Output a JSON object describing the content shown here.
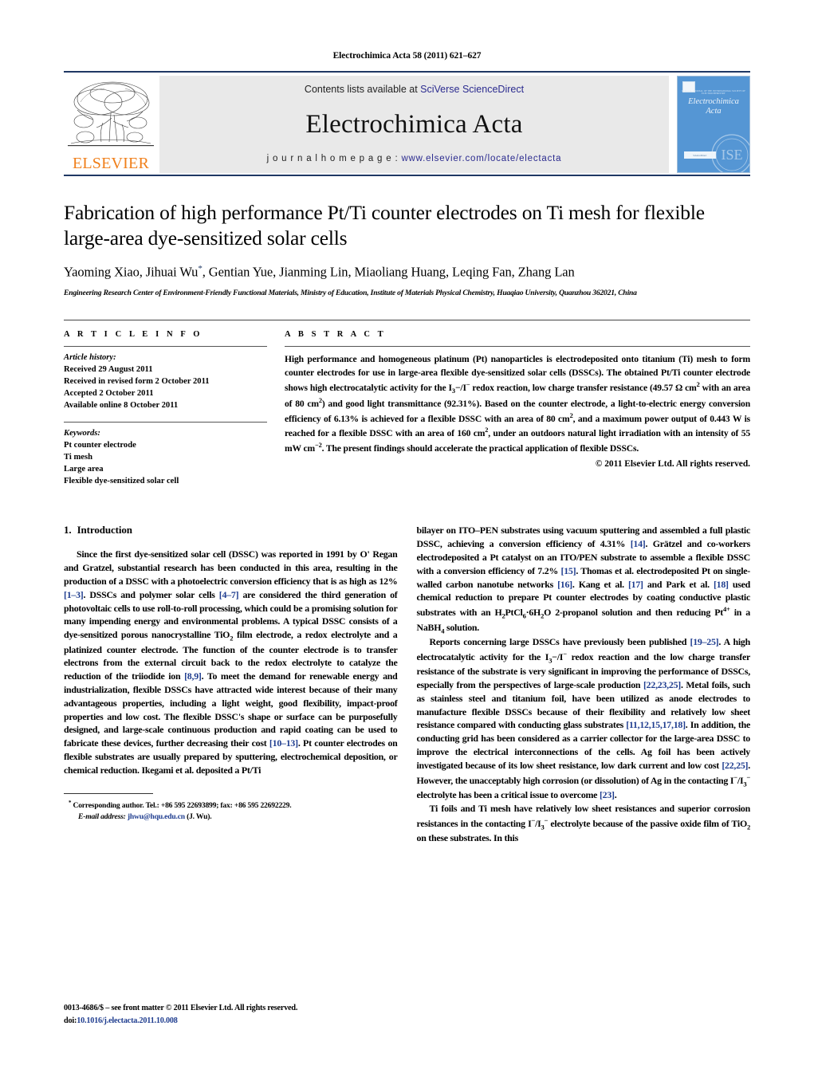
{
  "running_head": "Electrochimica Acta 58 (2011) 621–627",
  "masthead": {
    "publisher_logo_text": "ELSEVIER",
    "contents_prefix": "Contents lists available at ",
    "contents_link": "SciVerse ScienceDirect",
    "journal_name": "Electrochimica Acta",
    "homepage_prefix": "j o u r n a l   h o m e p a g e :  ",
    "homepage_url": "www.elsevier.com/locate/electacta",
    "cover_title_line1": "Electrochimica",
    "cover_title_line2": "Acta",
    "cover_society_line": "OFFICIAL JOURNAL OF THE INTERNATIONAL SOCIETY OF ELECTROCHEMISTRY",
    "cover_sciencedirect": "ScienceDirect",
    "cover_ise_mark": "ISE",
    "accent_rule_color": "#1f3864",
    "link_color": "#2b2b8f",
    "elsevier_orange": "#F07F1A",
    "cover_blue": "#5596d4"
  },
  "article": {
    "title": "Fabrication of high performance Pt/Ti counter electrodes on Ti mesh for flexible large-area dye-sensitized solar cells",
    "authors": "Yaoming Xiao, Jihuai Wu",
    "authors_rest": ", Gentian Yue, Jianming Lin, Miaoliang Huang, Leqing Fan, Zhang Lan",
    "corresponding_marker": "*",
    "affiliation": "Engineering Research Center of Environment-Friendly Functional Materials, Ministry of Education, Institute of Materials Physical Chemistry, Huaqiao University, Quanzhou 362021, China"
  },
  "article_info": {
    "heading": "A R T I C L E   I N F O",
    "history_label": "Article history:",
    "history": [
      "Received 29 August 2011",
      "Received in revised form 2 October 2011",
      "Accepted 2 October 2011",
      "Available online 8 October 2011"
    ],
    "keywords_label": "Keywords:",
    "keywords": [
      "Pt counter electrode",
      "Ti mesh",
      "Large area",
      "Flexible dye-sensitized solar cell"
    ]
  },
  "abstract": {
    "heading": "A B S T R A C T",
    "para_1": "High performance and homogeneous platinum (Pt) nanoparticles is electrodeposited onto titanium (Ti) mesh to form counter electrodes for use in large-area flexible dye-sensitized solar cells (DSSCs). The obtained Pt/Ti counter electrode shows high electrocatalytic activity for the I",
    "redox_sub": "3",
    "redox_mid": "−/I",
    "redox_sup": "−",
    "para_2": " redox reaction, low charge transfer resistance (49.57 Ω cm",
    "sup_2a": "2",
    "para_3": " with an area of 80 cm",
    "sup_2b": "2",
    "para_4": ") and good light transmittance (92.31%). Based on the counter electrode, a light-to-electric energy conversion efficiency of 6.13% is achieved for a flexible DSSC with an area of 80 cm",
    "sup_2c": "2",
    "para_5": ", and a maximum power output of 0.443 W is reached for a flexible DSSC with an area of 160 cm",
    "sup_2d": "2",
    "para_6": ", under an outdoors natural light irradiation with an intensity of 55 mW cm",
    "sup_2e": "−2",
    "para_7": ". The present findings should accelerate the practical application of flexible DSSCs.",
    "copyright": "© 2011 Elsevier Ltd. All rights reserved."
  },
  "introduction": {
    "number": "1.",
    "title": "Introduction",
    "left_p1_a": "Since the first dye-sensitized solar cell (DSSC) was reported in 1991 by O' Regan and Gratzel, substantial research has been conducted in this area, resulting in the production of a DSSC with a photoelectric conversion efficiency that is as high as 12% ",
    "left_ref1": "[1–3]",
    "left_p1_b": ". DSSCs and polymer solar cells ",
    "left_ref2": "[4–7]",
    "left_p1_c": " are considered the third generation of photovoltaic cells to use roll-to-roll processing, which could be a promising solution for many impending energy and environmental problems. A typical DSSC consists of a dye-sensitized porous nanocrystalline TiO",
    "left_sub1": "2",
    "left_p1_d": " film electrode, a redox electrolyte and a platinized counter electrode. The function of the counter electrode is to transfer electrons from the external circuit back to the redox electrolyte to catalyze the reduction of the triiodide ion ",
    "left_ref3": "[8,9]",
    "left_p1_e": ". To meet the demand for renewable energy and industrialization, flexible DSSCs have attracted wide interest because of their many advantageous properties, including a light weight, good flexibility, impact-proof properties and low cost. The flexible DSSC's shape or surface can be purposefully designed, and large-scale continuous production and rapid coating can be used to fabricate these devices, further decreasing their cost ",
    "left_ref4": "[10–13]",
    "left_p1_f": ". Pt counter electrodes on flexible substrates are usually prepared by sputtering, electrochemical deposition, or chemical reduction. Ikegami et al. deposited a Pt/Ti",
    "right_p1_a": "bilayer on ITO–PEN substrates using vacuum sputtering and assembled a full plastic DSSC, achieving a conversion efficiency of 4.31% ",
    "right_ref1": "[14]",
    "right_p1_b": ". Grätzel and co-workers electrodeposited a Pt catalyst on an ITO/PEN substrate to assemble a flexible DSSC with a conversion efficiency of 7.2% ",
    "right_ref2": "[15]",
    "right_p1_c": ". Thomas et al. electrodeposited Pt on single-walled carbon nanotube networks ",
    "right_ref3": "[16]",
    "right_p1_d": ". Kang et al. ",
    "right_ref4": "[17]",
    "right_p1_e": " and Park et al. ",
    "right_ref5": "[18]",
    "right_p1_f": " used chemical reduction to prepare Pt counter electrodes by coating conductive plastic substrates with an H",
    "right_sub1": "2",
    "right_p1_g": "PtCl",
    "right_sub2": "6",
    "right_p1_h": "·6H",
    "right_sub3": "2",
    "right_p1_i": "O 2-propanol solution and then reducing Pt",
    "right_sup1": "4+",
    "right_p1_j": " in a NaBH",
    "right_sub4": "4",
    "right_p1_k": " solution.",
    "right_p2_a": "Reports concerning large DSSCs have previously been published ",
    "right_ref6": "[19–25]",
    "right_p2_b": ". A high electrocatalytic activity for the I",
    "right_sub5": "3",
    "right_p2_c": "−/I",
    "right_sup2": "−",
    "right_p2_d": " redox reaction and the low charge transfer resistance of the substrate is very significant in improving the performance of DSSCs, especially from the perspectives of large-scale production ",
    "right_ref7": "[22,23,25]",
    "right_p2_e": ". Metal foils, such as stainless steel and titanium foil, have been utilized as anode electrodes to manufacture flexible DSSCs because of their flexibility and relatively low sheet resistance compared with conducting glass substrates ",
    "right_ref8": "[11,12,15,17,18]",
    "right_p2_f": ". In addition, the conducting grid has been considered as a carrier collector for the large-area DSSC to improve the electrical interconnections of the cells. Ag foil has been actively investigated because of its low sheet resistance, low dark current and low cost ",
    "right_ref9": "[22,25]",
    "right_p2_g": ". However, the unacceptably high corrosion (or dissolution) of Ag in the contacting I",
    "right_sup3": "−",
    "right_p2_h": "/I",
    "right_sub6": "3",
    "right_sup4": "−",
    "right_p2_i": " electrolyte has been a critical issue to overcome ",
    "right_ref10": "[23]",
    "right_p2_j": ".",
    "right_p3_a": "Ti foils and Ti mesh have relatively low sheet resistances and superior corrosion resistances in the contacting I",
    "right_sup5": "−",
    "right_p3_b": "/I",
    "right_sub7": "3",
    "right_sup6": "−",
    "right_p3_c": " electrolyte because of the passive oxide film of TiO",
    "right_sub8": "2",
    "right_p3_d": " on these substrates. In this"
  },
  "footnote": {
    "marker": "*",
    "line1": " Corresponding author. Tel.: +86 595 22693899; fax: +86 595 22692229.",
    "email_label": "E-mail address:",
    "email": "jhwu@hqu.edu.cn",
    "email_suffix": " (J. Wu)."
  },
  "issn_block": {
    "line1": "0013-4686/$ – see front matter © 2011 Elsevier Ltd. All rights reserved.",
    "doi_label": "doi:",
    "doi": "10.1016/j.electacta.2011.10.008"
  }
}
